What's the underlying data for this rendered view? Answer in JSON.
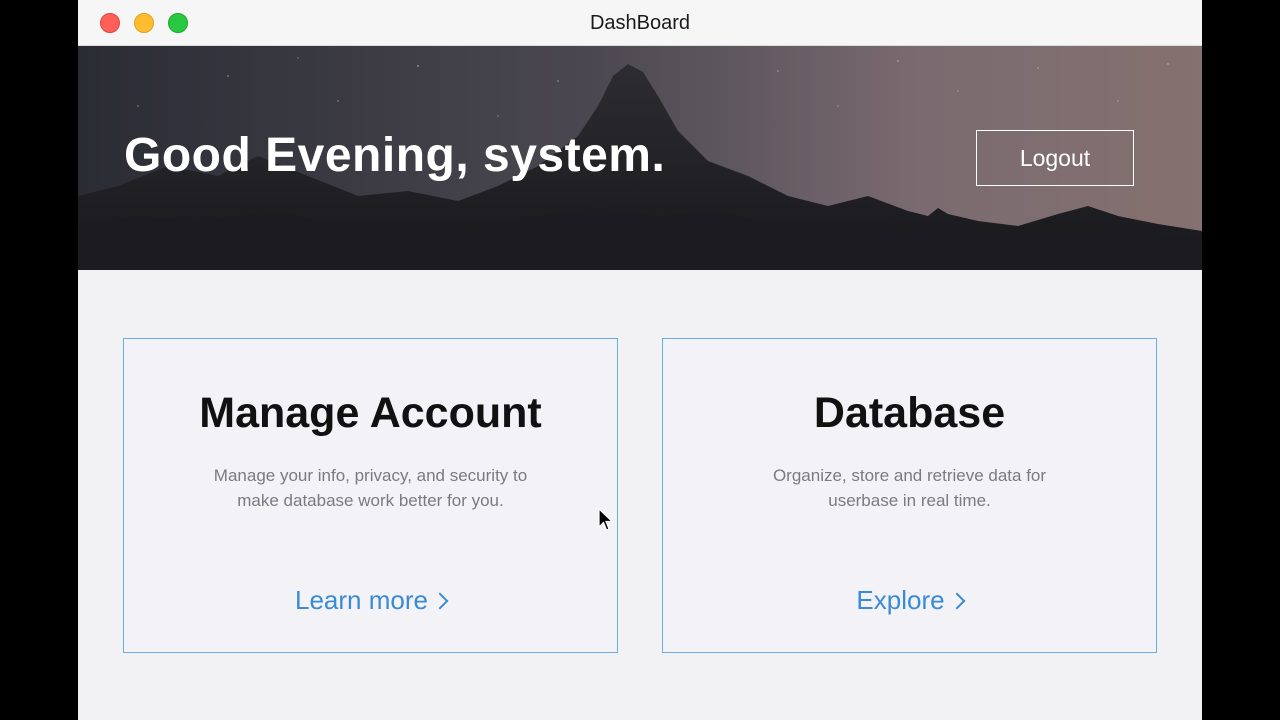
{
  "window": {
    "title": "DashBoard"
  },
  "hero": {
    "greeting": "Good Evening, system.",
    "logout_label": "Logout"
  },
  "cards": [
    {
      "title": "Manage Account",
      "description_line1": "Manage your info, privacy, and security to",
      "description_line2": "make database work better for you.",
      "link_label": "Learn more",
      "link_icon": "chevron-right-icon"
    },
    {
      "title": "Database",
      "description_line1": "Organize, store and retrieve data for",
      "description_line2": "userbase in real time.",
      "link_label": "Explore",
      "link_icon": "chevron-right-icon"
    }
  ],
  "colors": {
    "accent": "#3a8ad6",
    "card_border": "#6aaee6",
    "background": "#f2f2f5"
  }
}
